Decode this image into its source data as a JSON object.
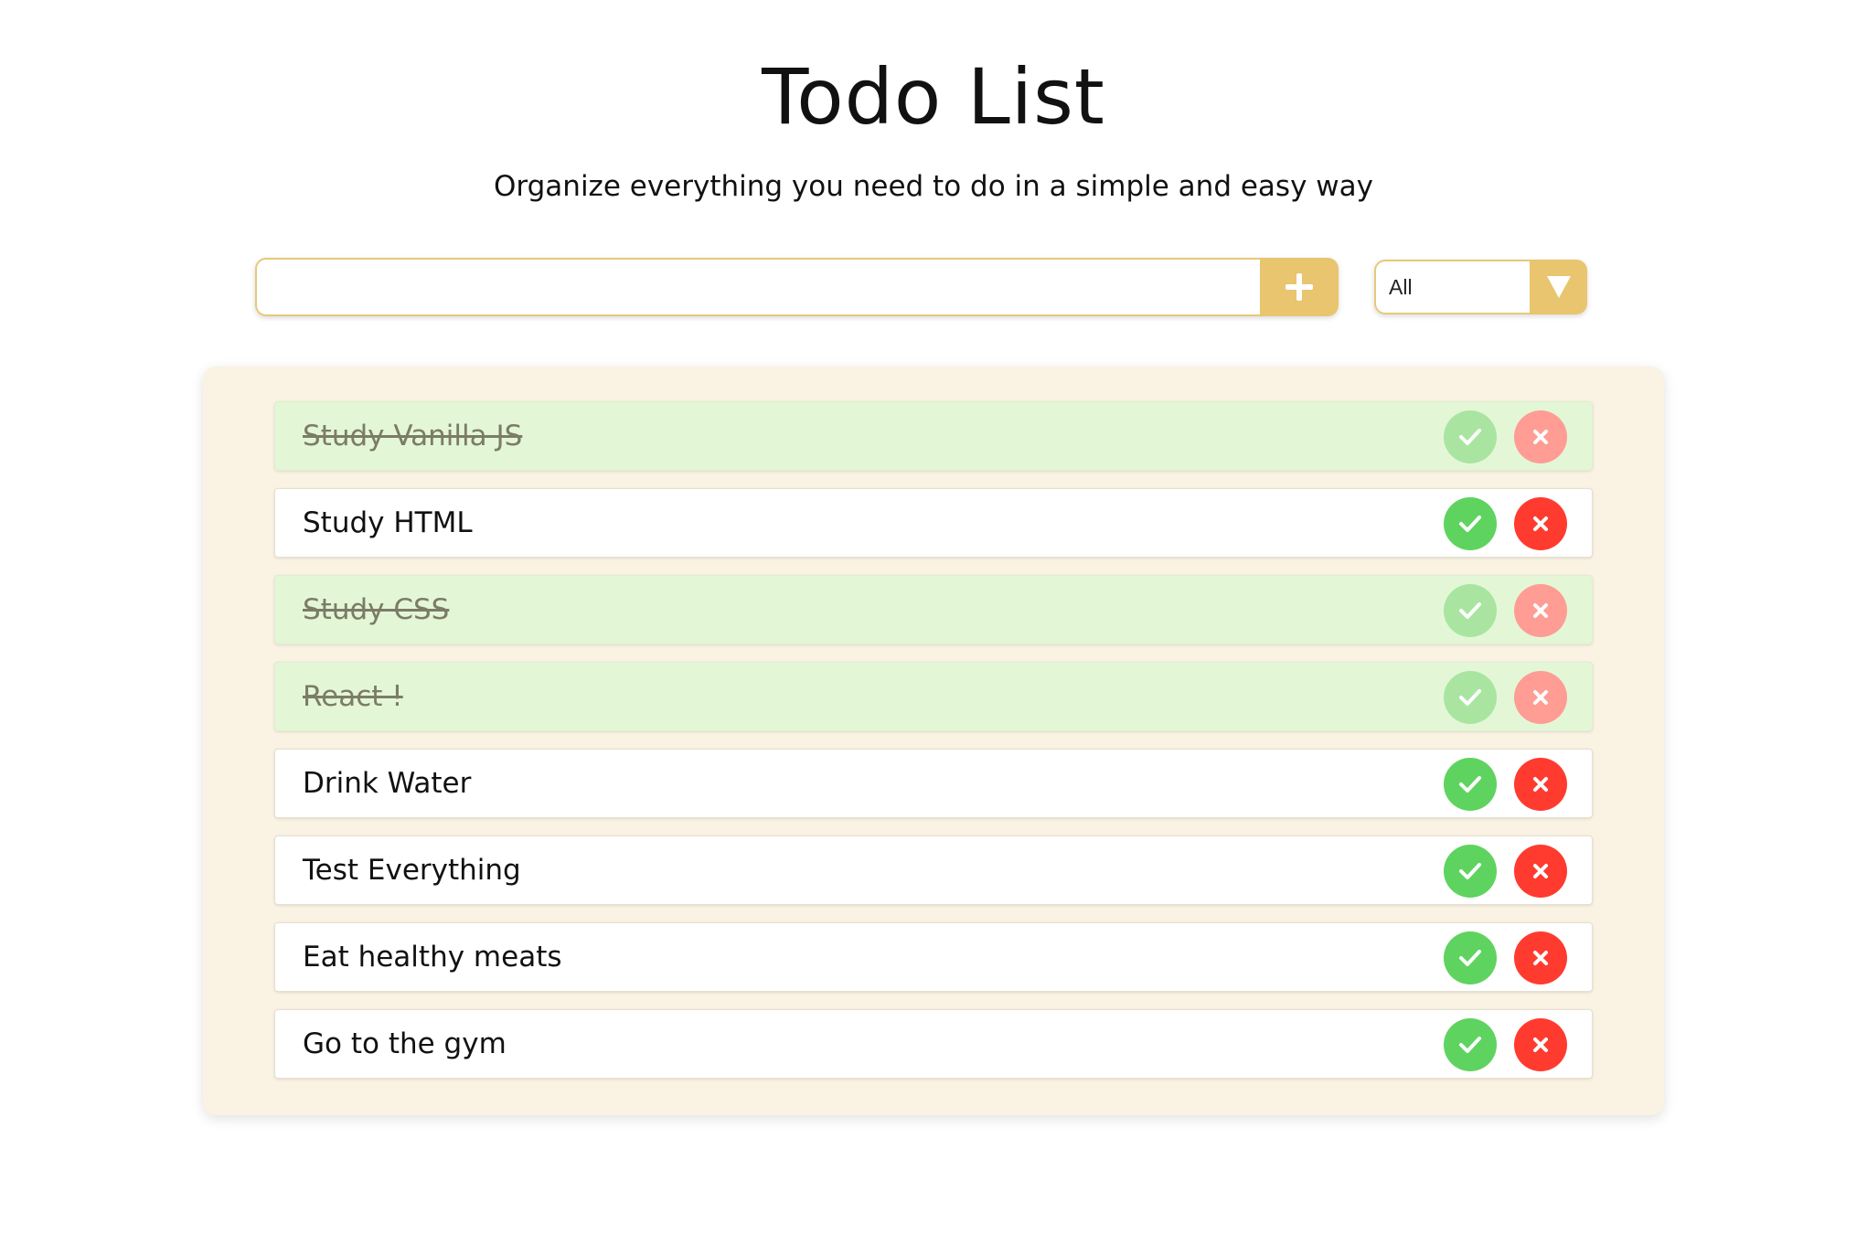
{
  "header": {
    "title": "Todo List",
    "subtitle": "Organize everything you need to do in a simple and easy way"
  },
  "add_form": {
    "input_value": "",
    "input_placeholder": "",
    "add_icon": "plus-icon"
  },
  "filter": {
    "selected": "All",
    "icon": "chevron-down-icon"
  },
  "todos": [
    {
      "text": "Study Vanilla JS",
      "completed": true
    },
    {
      "text": "Study HTML",
      "completed": false
    },
    {
      "text": "Study CSS",
      "completed": true
    },
    {
      "text": "React !",
      "completed": true
    },
    {
      "text": "Drink Water",
      "completed": false
    },
    {
      "text": "Test Everything",
      "completed": false
    },
    {
      "text": "Eat healthy meats",
      "completed": false
    },
    {
      "text": "Go to the gym",
      "completed": false
    }
  ],
  "item_actions": {
    "complete_icon": "check-icon",
    "delete_icon": "close-icon"
  },
  "colors": {
    "accent": "#e8c56e",
    "panel_background": "#faf2e2",
    "completed_background": "#e3f7d7",
    "complete_green": "#5fd35f",
    "delete_red": "#ff3b30"
  }
}
